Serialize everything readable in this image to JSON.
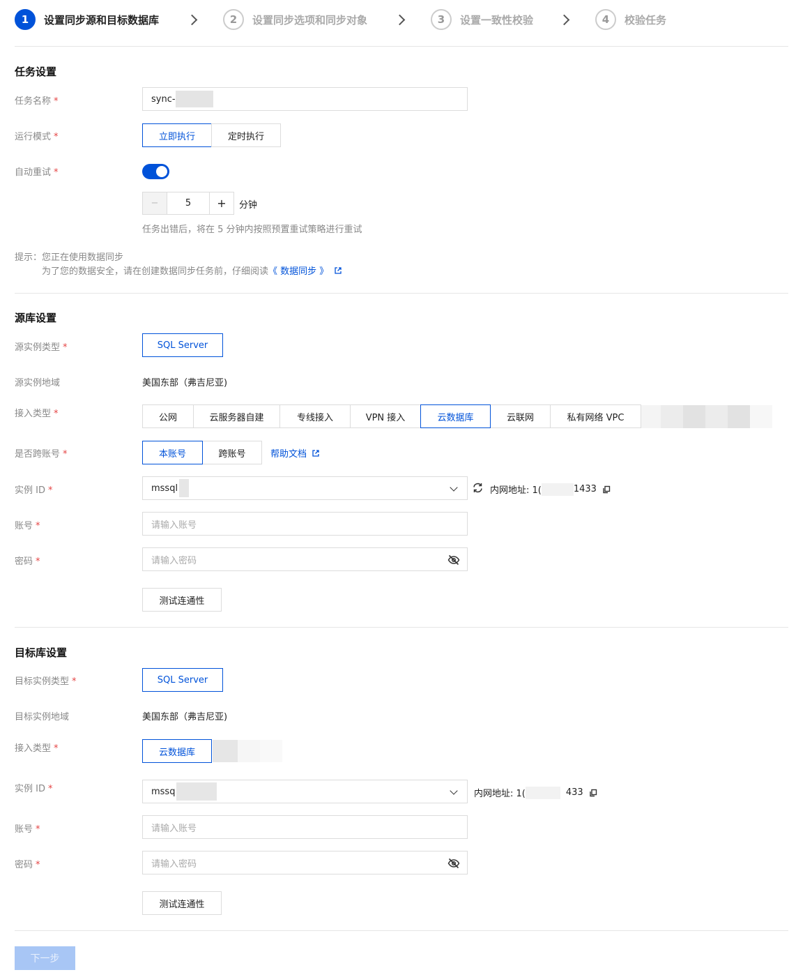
{
  "steps": [
    {
      "num": "1",
      "label": "设置同步源和目标数据库"
    },
    {
      "num": "2",
      "label": "设置同步选项和同步对象"
    },
    {
      "num": "3",
      "label": "设置一致性校验"
    },
    {
      "num": "4",
      "label": "校验任务"
    }
  ],
  "task": {
    "title": "任务设置",
    "name_label": "任务名称",
    "name_value": "sync-",
    "mode_label": "运行模式",
    "mode_options": [
      "立即执行",
      "定时执行"
    ],
    "retry_label": "自动重试",
    "retry_value": "5",
    "retry_unit": "分钟",
    "retry_minus": "−",
    "retry_plus": "+",
    "retry_hint": "任务出错后，将在 5 分钟内按照预置重试策略进行重试",
    "tip_line1": "提示：您正在使用数据同步",
    "tip_line2": "为了您的数据安全，请在创建数据同步任务前，仔细阅读",
    "tip_link": "《 数据同步 》"
  },
  "source": {
    "title": "源库设置",
    "type_label": "源实例类型",
    "type_value": "SQL Server",
    "region_label": "源实例地域",
    "region_value": "美国东部（弗吉尼亚)",
    "access_label": "接入类型",
    "access_options": [
      "公网",
      "云服务器自建",
      "专线接入",
      "VPN 接入",
      "云数据库",
      "云联网",
      "私有网络 VPC"
    ],
    "cross_label": "是否跨账号",
    "cross_options": [
      "本账号",
      "跨账号"
    ],
    "help_link": "帮助文档",
    "instance_label": "实例 ID",
    "instance_value": "mssql",
    "intranet_label": "内网地址: 1(",
    "intranet_port": "1433",
    "account_label": "账号",
    "account_placeholder": "请输入账号",
    "password_label": "密码",
    "password_placeholder": "请输入密码",
    "test_button": "测试连通性"
  },
  "target": {
    "title": "目标库设置",
    "type_label": "目标实例类型",
    "type_value": "SQL Server",
    "region_label": "目标实例地域",
    "region_value": "美国东部（弗吉尼亚)",
    "access_label": "接入类型",
    "access_option": "云数据库",
    "instance_label": "实例 ID",
    "instance_value": "mssq",
    "intranet_label": "内网地址: 1(",
    "intranet_port": "433",
    "account_label": "账号",
    "account_placeholder": "请输入账号",
    "password_label": "密码",
    "password_placeholder": "请输入密码",
    "test_button": "测试连通性"
  },
  "footer": {
    "next_button": "下一步"
  },
  "colors": {
    "accent": "#0052d9",
    "required": "#e54545",
    "disabled_button": "#a8c6f5"
  }
}
